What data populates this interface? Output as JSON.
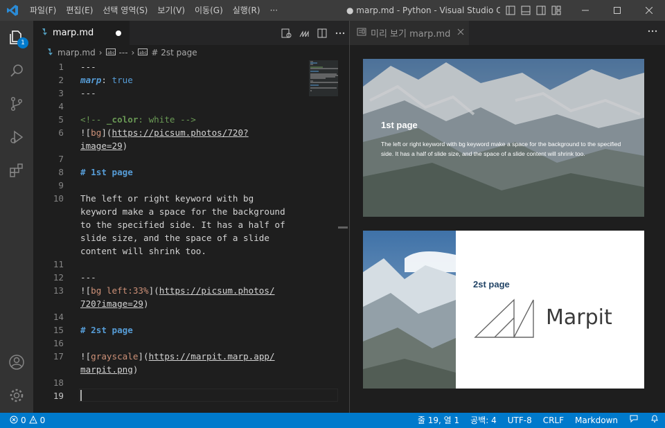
{
  "menu": {
    "items": [
      "파일(F)",
      "편집(E)",
      "선택 영역(S)",
      "보기(V)",
      "이동(G)",
      "실행(R)",
      "···"
    ]
  },
  "window": {
    "title": "● marp.md - Python - Visual Studio Code"
  },
  "activity": {
    "explorer_badge": "1"
  },
  "editor": {
    "tab_label": "marp.md",
    "breadcrumb": {
      "file": "marp.md",
      "sep": "›",
      "item1": "---",
      "item2": "# 2st page"
    },
    "line_numbers": [
      "1",
      "2",
      "3",
      "4",
      "5",
      "6",
      "7",
      "8",
      "9",
      "10",
      "11",
      "12",
      "13",
      "14",
      "15",
      "16",
      "17",
      "18",
      "19"
    ],
    "code": {
      "l1": "---",
      "l2_key": "marp",
      "l2_colon": ": ",
      "l2_val": "true",
      "l3": "---",
      "l5_open": "<!-- ",
      "l5_key": "_color",
      "l5_rest": ": white -->",
      "l6_open": "![",
      "l6_alt": "bg",
      "l6_mid": "](",
      "l6_url": "https://picsum.photos/720?",
      "l6b_url": "image=29",
      "l6b_close": ")",
      "l8_hash": "#",
      "l8_text": " 1st page",
      "l10a": "The left or right keyword with bg",
      "l10b": "keyword make a space for the background",
      "l10c": "to the specified side. It has a half of",
      "l10d": "slide size, and the space of a slide",
      "l10e": "content will shrink too.",
      "l12": "---",
      "l13_open": "![",
      "l13_alt": "bg left:33%",
      "l13_mid": "](",
      "l13_url": "https://picsum.photos/",
      "l13b_url": "720?image=29",
      "l13b_close": ")",
      "l15_hash": "#",
      "l15_text": " 2st page",
      "l17_open": "![",
      "l17_alt": "grayscale",
      "l17_mid": "](",
      "l17_url": "https://marpit.marp.app/",
      "l17b_url": "marpit.png",
      "l17b_close": ")"
    }
  },
  "preview": {
    "tab_label": "미리 보기 marp.md",
    "slide1": {
      "title": "1st page",
      "body": "The left or right keyword with bg keyword make a space for the background to the specified side. It has a half of slide size, and the space of a slide content will shrink too."
    },
    "slide2": {
      "title": "2st page",
      "logo_text": "Marpit"
    }
  },
  "status": {
    "errors": "0",
    "warnings": "0",
    "position": "줄 19, 열 1",
    "indent": "공백: 4",
    "encoding": "UTF-8",
    "eol": "CRLF",
    "language": "Markdown"
  },
  "colors": {
    "accent": "#007acc",
    "titlebar": "#3c3c3c",
    "activitybar": "#333333",
    "editor_bg": "#1e1e1e",
    "keyword": "#569cd6",
    "string": "#ce9178",
    "comment": "#6a9955"
  }
}
